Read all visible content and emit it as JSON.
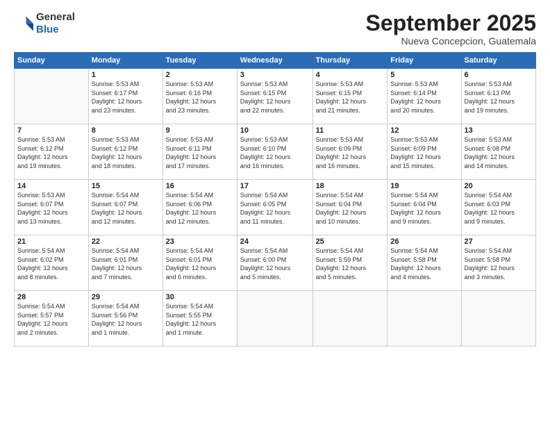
{
  "logo": {
    "general": "General",
    "blue": "Blue"
  },
  "header": {
    "month": "September 2025",
    "location": "Nueva Concepcion, Guatemala"
  },
  "weekdays": [
    "Sunday",
    "Monday",
    "Tuesday",
    "Wednesday",
    "Thursday",
    "Friday",
    "Saturday"
  ],
  "weeks": [
    [
      {
        "day": "",
        "info": ""
      },
      {
        "day": "1",
        "info": "Sunrise: 5:53 AM\nSunset: 6:17 PM\nDaylight: 12 hours\nand 23 minutes."
      },
      {
        "day": "2",
        "info": "Sunrise: 5:53 AM\nSunset: 6:16 PM\nDaylight: 12 hours\nand 23 minutes."
      },
      {
        "day": "3",
        "info": "Sunrise: 5:53 AM\nSunset: 6:15 PM\nDaylight: 12 hours\nand 22 minutes."
      },
      {
        "day": "4",
        "info": "Sunrise: 5:53 AM\nSunset: 6:15 PM\nDaylight: 12 hours\nand 21 minutes."
      },
      {
        "day": "5",
        "info": "Sunrise: 5:53 AM\nSunset: 6:14 PM\nDaylight: 12 hours\nand 20 minutes."
      },
      {
        "day": "6",
        "info": "Sunrise: 5:53 AM\nSunset: 6:13 PM\nDaylight: 12 hours\nand 19 minutes."
      }
    ],
    [
      {
        "day": "7",
        "info": "Sunrise: 5:53 AM\nSunset: 6:12 PM\nDaylight: 12 hours\nand 19 minutes."
      },
      {
        "day": "8",
        "info": "Sunrise: 5:53 AM\nSunset: 6:12 PM\nDaylight: 12 hours\nand 18 minutes."
      },
      {
        "day": "9",
        "info": "Sunrise: 5:53 AM\nSunset: 6:11 PM\nDaylight: 12 hours\nand 17 minutes."
      },
      {
        "day": "10",
        "info": "Sunrise: 5:53 AM\nSunset: 6:10 PM\nDaylight: 12 hours\nand 16 minutes."
      },
      {
        "day": "11",
        "info": "Sunrise: 5:53 AM\nSunset: 6:09 PM\nDaylight: 12 hours\nand 16 minutes."
      },
      {
        "day": "12",
        "info": "Sunrise: 5:53 AM\nSunset: 6:09 PM\nDaylight: 12 hours\nand 15 minutes."
      },
      {
        "day": "13",
        "info": "Sunrise: 5:53 AM\nSunset: 6:08 PM\nDaylight: 12 hours\nand 14 minutes."
      }
    ],
    [
      {
        "day": "14",
        "info": "Sunrise: 5:53 AM\nSunset: 6:07 PM\nDaylight: 12 hours\nand 13 minutes."
      },
      {
        "day": "15",
        "info": "Sunrise: 5:54 AM\nSunset: 6:07 PM\nDaylight: 12 hours\nand 12 minutes."
      },
      {
        "day": "16",
        "info": "Sunrise: 5:54 AM\nSunset: 6:06 PM\nDaylight: 12 hours\nand 12 minutes."
      },
      {
        "day": "17",
        "info": "Sunrise: 5:54 AM\nSunset: 6:05 PM\nDaylight: 12 hours\nand 11 minutes."
      },
      {
        "day": "18",
        "info": "Sunrise: 5:54 AM\nSunset: 6:04 PM\nDaylight: 12 hours\nand 10 minutes."
      },
      {
        "day": "19",
        "info": "Sunrise: 5:54 AM\nSunset: 6:04 PM\nDaylight: 12 hours\nand 9 minutes."
      },
      {
        "day": "20",
        "info": "Sunrise: 5:54 AM\nSunset: 6:03 PM\nDaylight: 12 hours\nand 9 minutes."
      }
    ],
    [
      {
        "day": "21",
        "info": "Sunrise: 5:54 AM\nSunset: 6:02 PM\nDaylight: 12 hours\nand 8 minutes."
      },
      {
        "day": "22",
        "info": "Sunrise: 5:54 AM\nSunset: 6:01 PM\nDaylight: 12 hours\nand 7 minutes."
      },
      {
        "day": "23",
        "info": "Sunrise: 5:54 AM\nSunset: 6:01 PM\nDaylight: 12 hours\nand 6 minutes."
      },
      {
        "day": "24",
        "info": "Sunrise: 5:54 AM\nSunset: 6:00 PM\nDaylight: 12 hours\nand 5 minutes."
      },
      {
        "day": "25",
        "info": "Sunrise: 5:54 AM\nSunset: 5:59 PM\nDaylight: 12 hours\nand 5 minutes."
      },
      {
        "day": "26",
        "info": "Sunrise: 5:54 AM\nSunset: 5:58 PM\nDaylight: 12 hours\nand 4 minutes."
      },
      {
        "day": "27",
        "info": "Sunrise: 5:54 AM\nSunset: 5:58 PM\nDaylight: 12 hours\nand 3 minutes."
      }
    ],
    [
      {
        "day": "28",
        "info": "Sunrise: 5:54 AM\nSunset: 5:57 PM\nDaylight: 12 hours\nand 2 minutes."
      },
      {
        "day": "29",
        "info": "Sunrise: 5:54 AM\nSunset: 5:56 PM\nDaylight: 12 hours\nand 1 minute."
      },
      {
        "day": "30",
        "info": "Sunrise: 5:54 AM\nSunset: 5:55 PM\nDaylight: 12 hours\nand 1 minute."
      },
      {
        "day": "",
        "info": ""
      },
      {
        "day": "",
        "info": ""
      },
      {
        "day": "",
        "info": ""
      },
      {
        "day": "",
        "info": ""
      }
    ]
  ]
}
